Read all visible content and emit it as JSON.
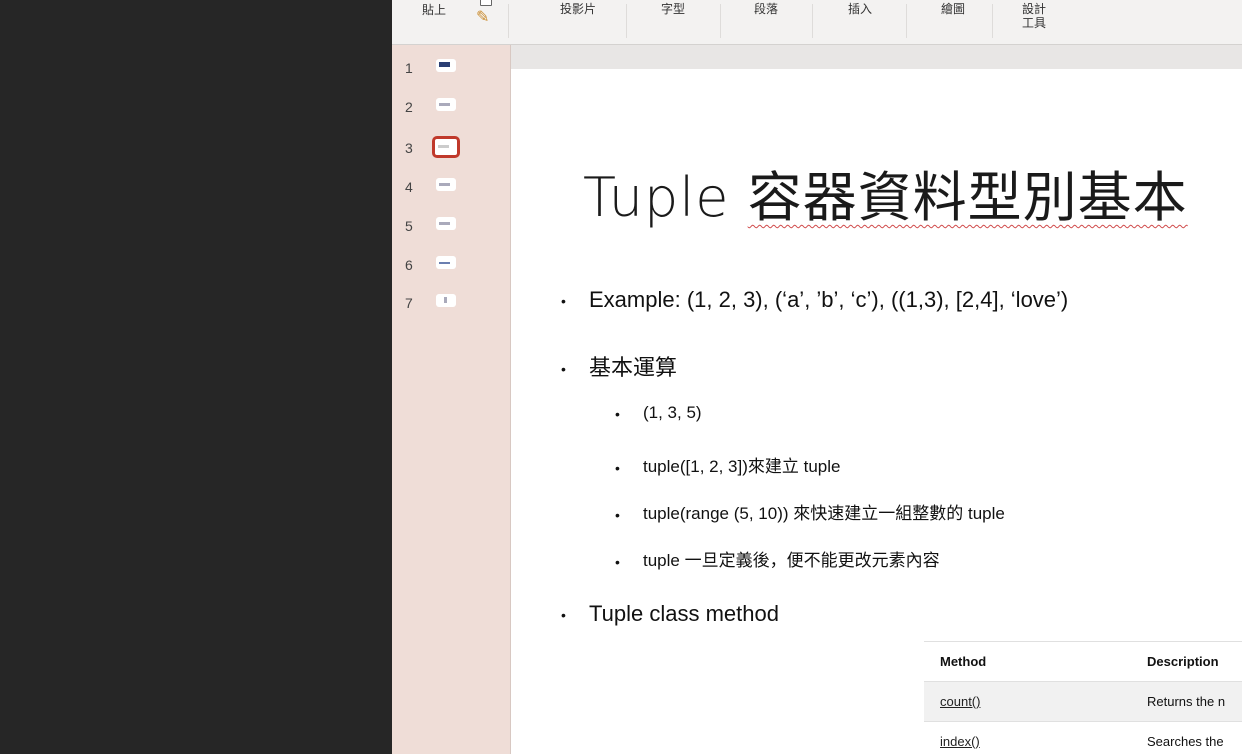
{
  "ribbon": {
    "paste_label": "貼上",
    "groups": [
      "投影片",
      "字型",
      "段落",
      "插入",
      "繪圖",
      "設計\n工具"
    ]
  },
  "thumbnails": {
    "numbers": [
      "1",
      "2",
      "3",
      "4",
      "5",
      "6",
      "7"
    ],
    "selected": 3
  },
  "slide": {
    "title_latin": "Tuple",
    "title_cjk": "容器資料型別基本",
    "bullets": [
      {
        "level": 1,
        "text": "Example: (1, 2, 3), (‘a’, ’b’, ‘c’),  ((1,3), [2,4], ‘love’)"
      },
      {
        "level": 1,
        "text": "基本運算"
      },
      {
        "level": 2,
        "text": "(1, 3, 5)"
      },
      {
        "level": 2,
        "text": "tuple([1, 2, 3])來建立 tuple"
      },
      {
        "level": 2,
        "text": "tuple(range (5, 10)) 來快速建立一組整數的 tuple"
      },
      {
        "level": 2,
        "text": "tuple 一旦定義後，便不能更改元素內容"
      },
      {
        "level": 1,
        "text": "Tuple class method"
      }
    ],
    "table": {
      "headers": [
        "Method",
        "Description"
      ],
      "rows": [
        [
          "count()",
          "Returns the n"
        ],
        [
          "index()",
          "Searches the"
        ]
      ]
    }
  },
  "colors": {
    "thumbnail_panel": "#efddd7",
    "selection_outline": "#c0392b",
    "spellcheck_underline": "#d04a4a"
  }
}
